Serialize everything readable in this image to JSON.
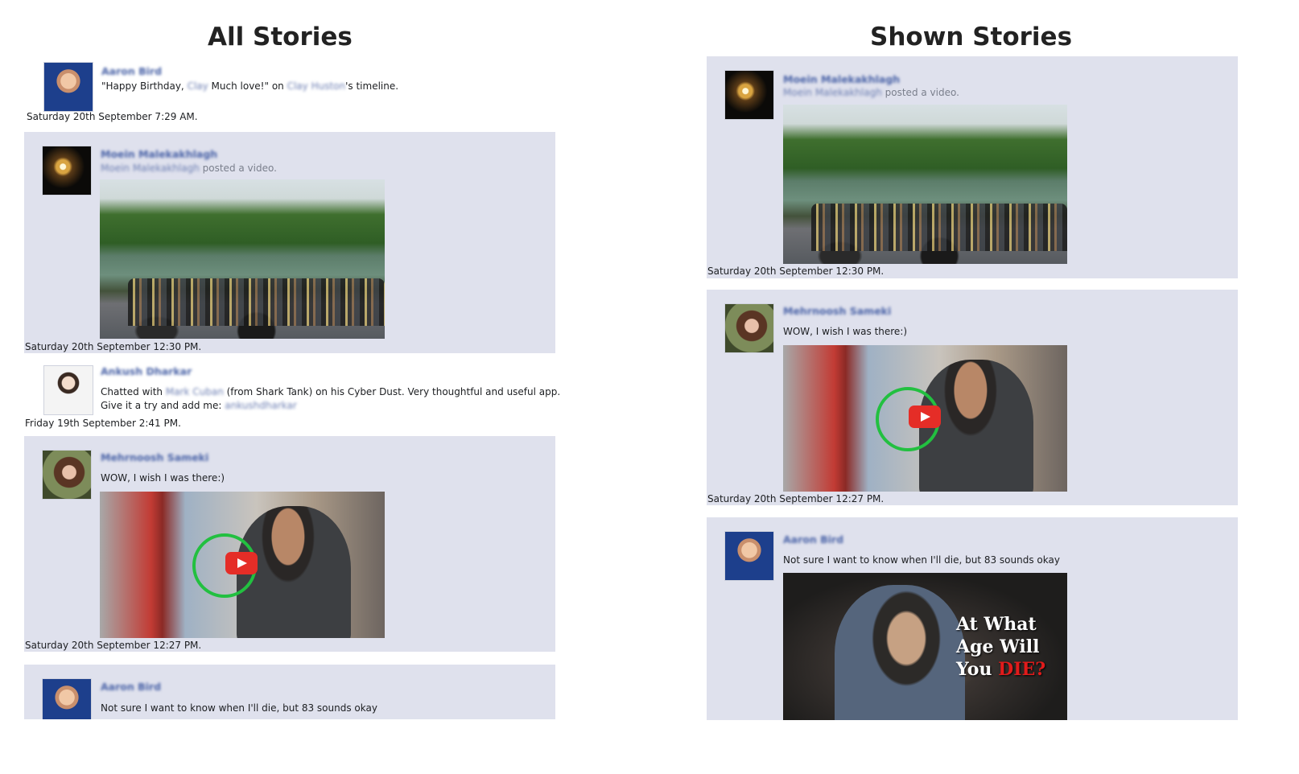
{
  "left": {
    "title": "All Stories",
    "stories": [
      {
        "name": "Aaron Bird",
        "line_parts": [
          "\"Happy Birthday, ",
          "Clay",
          " Much love!\" on ",
          "Clay Huston",
          "'s timeline."
        ],
        "timestamp": "Saturday 20th September 7:29 AM."
      },
      {
        "name": "Moein Malekakhlagh",
        "sub_name": "Moein Malekakhlagh",
        "sub_action": "posted a video.",
        "timestamp": "Saturday 20th September 12:30 PM."
      },
      {
        "name": "Ankush Dharkar",
        "line1_parts": [
          "Chatted with ",
          "Mark Cuban",
          " (from Shark Tank) on his Cyber Dust. Very thoughtful and useful app."
        ],
        "line2_parts": [
          "Give it a try and add me: ",
          "ankushdharkar"
        ],
        "timestamp": "Friday 19th September 2:41 PM."
      },
      {
        "name": "Mehrnoosh Sameki",
        "text": "WOW, I wish I was there:)",
        "timestamp": "Saturday 20th September 12:27 PM."
      },
      {
        "name": "Aaron Bird",
        "text": "Not sure I want to know when I'll die, but 83 sounds okay"
      }
    ]
  },
  "right": {
    "title": "Shown Stories",
    "stories": [
      {
        "name": "Moein Malekakhlagh",
        "sub_name": "Moein Malekakhlagh",
        "sub_action": "posted a video.",
        "timestamp": "Saturday 20th September 12:30 PM."
      },
      {
        "name": "Mehrnoosh Sameki",
        "text": "WOW, I wish I was there:)",
        "timestamp": "Saturday 20th September 12:27 PM."
      },
      {
        "name": "Aaron Bird",
        "text": "Not sure I want to know when I'll die, but 83 sounds okay",
        "image_text": [
          "At What",
          "Age Will",
          "You ",
          "DIE?"
        ]
      }
    ]
  },
  "colors": {
    "story_bg": "#dfe1ed",
    "name_link": "#4a63a7",
    "play_button": "#e52d27",
    "ring": "#22c040"
  },
  "icons": [
    "play-icon"
  ]
}
